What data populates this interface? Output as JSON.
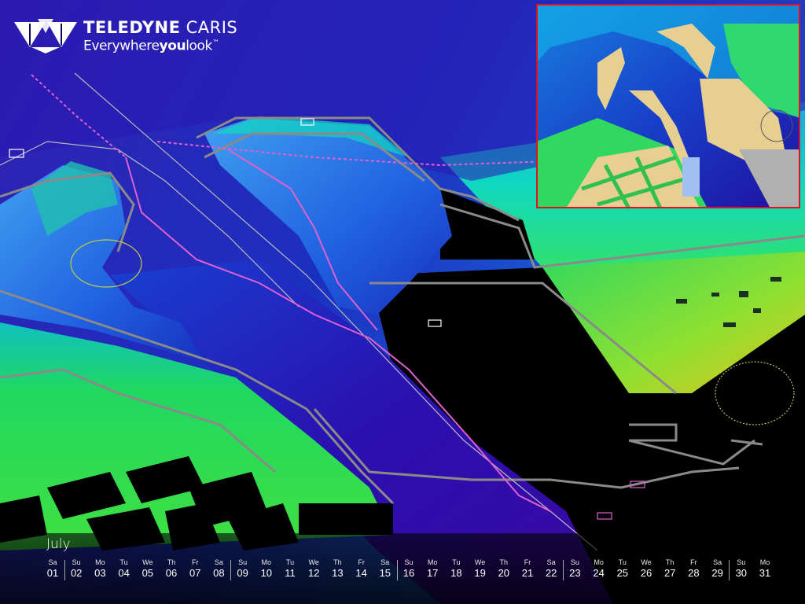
{
  "brand": {
    "company_bold": "TELEDYNE",
    "company_regular": " CARIS",
    "tagline_start": "Everywhere",
    "tagline_bold": "you",
    "tagline_end": "look",
    "trademark": "™"
  },
  "calendar": {
    "month": "July",
    "days": [
      {
        "dow": "Sa",
        "num": "01"
      },
      {
        "dow": "Su",
        "num": "02"
      },
      {
        "dow": "Mo",
        "num": "03"
      },
      {
        "dow": "Tu",
        "num": "04"
      },
      {
        "dow": "We",
        "num": "05"
      },
      {
        "dow": "Th",
        "num": "06"
      },
      {
        "dow": "Fr",
        "num": "07"
      },
      {
        "dow": "Sa",
        "num": "08"
      },
      {
        "dow": "Su",
        "num": "09"
      },
      {
        "dow": "Mo",
        "num": "10"
      },
      {
        "dow": "Tu",
        "num": "11"
      },
      {
        "dow": "We",
        "num": "12"
      },
      {
        "dow": "Th",
        "num": "13"
      },
      {
        "dow": "Fr",
        "num": "14"
      },
      {
        "dow": "Sa",
        "num": "15"
      },
      {
        "dow": "Su",
        "num": "16"
      },
      {
        "dow": "Mo",
        "num": "17"
      },
      {
        "dow": "Tu",
        "num": "18"
      },
      {
        "dow": "We",
        "num": "19"
      },
      {
        "dow": "Th",
        "num": "20"
      },
      {
        "dow": "Fr",
        "num": "21"
      },
      {
        "dow": "Sa",
        "num": "22"
      },
      {
        "dow": "Su",
        "num": "23"
      },
      {
        "dow": "Mo",
        "num": "24"
      },
      {
        "dow": "Tu",
        "num": "25"
      },
      {
        "dow": "We",
        "num": "26"
      },
      {
        "dow": "Th",
        "num": "27"
      },
      {
        "dow": "Fr",
        "num": "28"
      },
      {
        "dow": "Sa",
        "num": "29"
      },
      {
        "dow": "Su",
        "num": "30"
      },
      {
        "dow": "Mo",
        "num": "31"
      }
    ]
  },
  "colors": {
    "deep_water": "#2a10a8",
    "mid_water": "#1060d8",
    "shallow_water": "#10c8e0",
    "land_green": "#28d850",
    "land_yellow": "#b8e020",
    "route_magenta": "#e060d0",
    "contour_gray": "#8a8a8a",
    "inset_border": "#e21020",
    "chart_land": "#e6cf90"
  }
}
